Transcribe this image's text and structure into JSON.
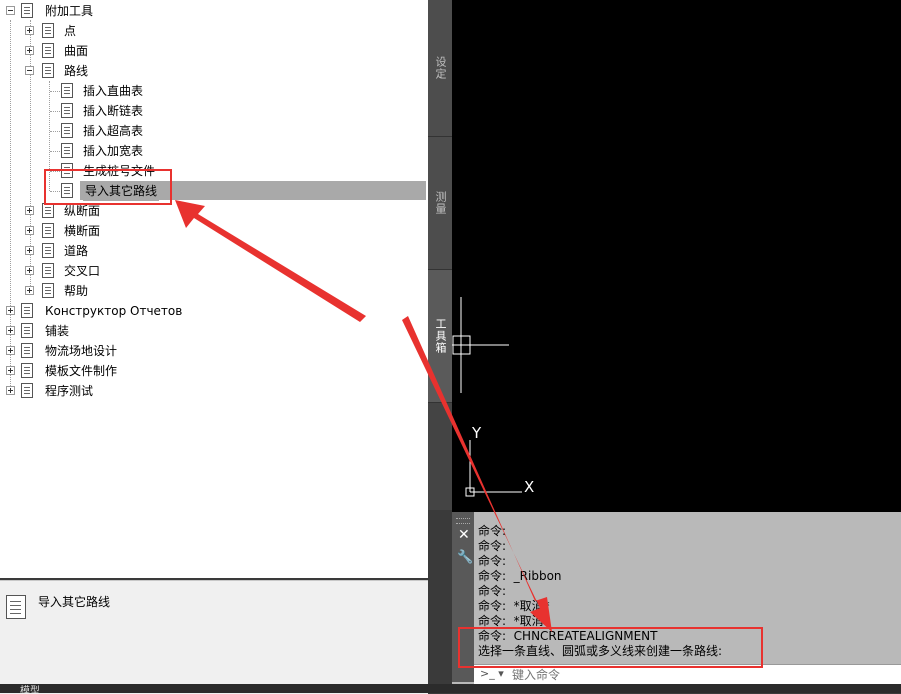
{
  "tree": {
    "items": [
      {
        "label": "附加工具",
        "level": 0,
        "expander": "minus"
      },
      {
        "label": "点",
        "level": 1,
        "expander": "plus"
      },
      {
        "label": "曲面",
        "level": 1,
        "expander": "plus"
      },
      {
        "label": "路线",
        "level": 1,
        "expander": "minus"
      },
      {
        "label": "插入直曲表",
        "level": 2,
        "expander": "none"
      },
      {
        "label": "插入断链表",
        "level": 2,
        "expander": "none"
      },
      {
        "label": "插入超高表",
        "level": 2,
        "expander": "none"
      },
      {
        "label": "插入加宽表",
        "level": 2,
        "expander": "none"
      },
      {
        "label": "生成桩号文件",
        "level": 2,
        "expander": "none"
      },
      {
        "label": "导入其它路线",
        "level": 2,
        "expander": "none",
        "selected": true
      },
      {
        "label": "纵断面",
        "level": 1,
        "expander": "plus"
      },
      {
        "label": "横断面",
        "level": 1,
        "expander": "plus"
      },
      {
        "label": "道路",
        "level": 1,
        "expander": "plus"
      },
      {
        "label": "交叉口",
        "level": 1,
        "expander": "plus"
      },
      {
        "label": "帮助",
        "level": 1,
        "expander": "plus"
      },
      {
        "label": "Конструктор Отчетов",
        "level": 0,
        "expander": "plus"
      },
      {
        "label": "铺装",
        "level": 0,
        "expander": "plus"
      },
      {
        "label": "物流场地设计",
        "level": 0,
        "expander": "plus"
      },
      {
        "label": "模板文件制作",
        "level": 0,
        "expander": "plus"
      },
      {
        "label": "程序测试",
        "level": 0,
        "expander": "plus"
      }
    ]
  },
  "description": {
    "text": "导入其它路线"
  },
  "side_tabs": [
    {
      "label": "设定",
      "active": false
    },
    {
      "label": "测量",
      "active": false
    },
    {
      "label": "工具箱",
      "active": true
    }
  ],
  "viewport": {
    "y_axis": "Y",
    "x_axis": "X"
  },
  "command": {
    "lines": [
      "命令:",
      "命令:",
      "命令:",
      "命令:  _Ribbon",
      "命令:",
      "命令:  *取消*",
      "命令:  *取消*",
      "命令:  CHNCREATEALIGNMENT",
      "选择一条直线、圆弧或多义线来创建一条路线:"
    ],
    "placeholder": "键入命令"
  },
  "status": {
    "tab_model": "模型"
  },
  "colors": {
    "highlight": "#e8322f",
    "selection": "#a9a9a9"
  }
}
